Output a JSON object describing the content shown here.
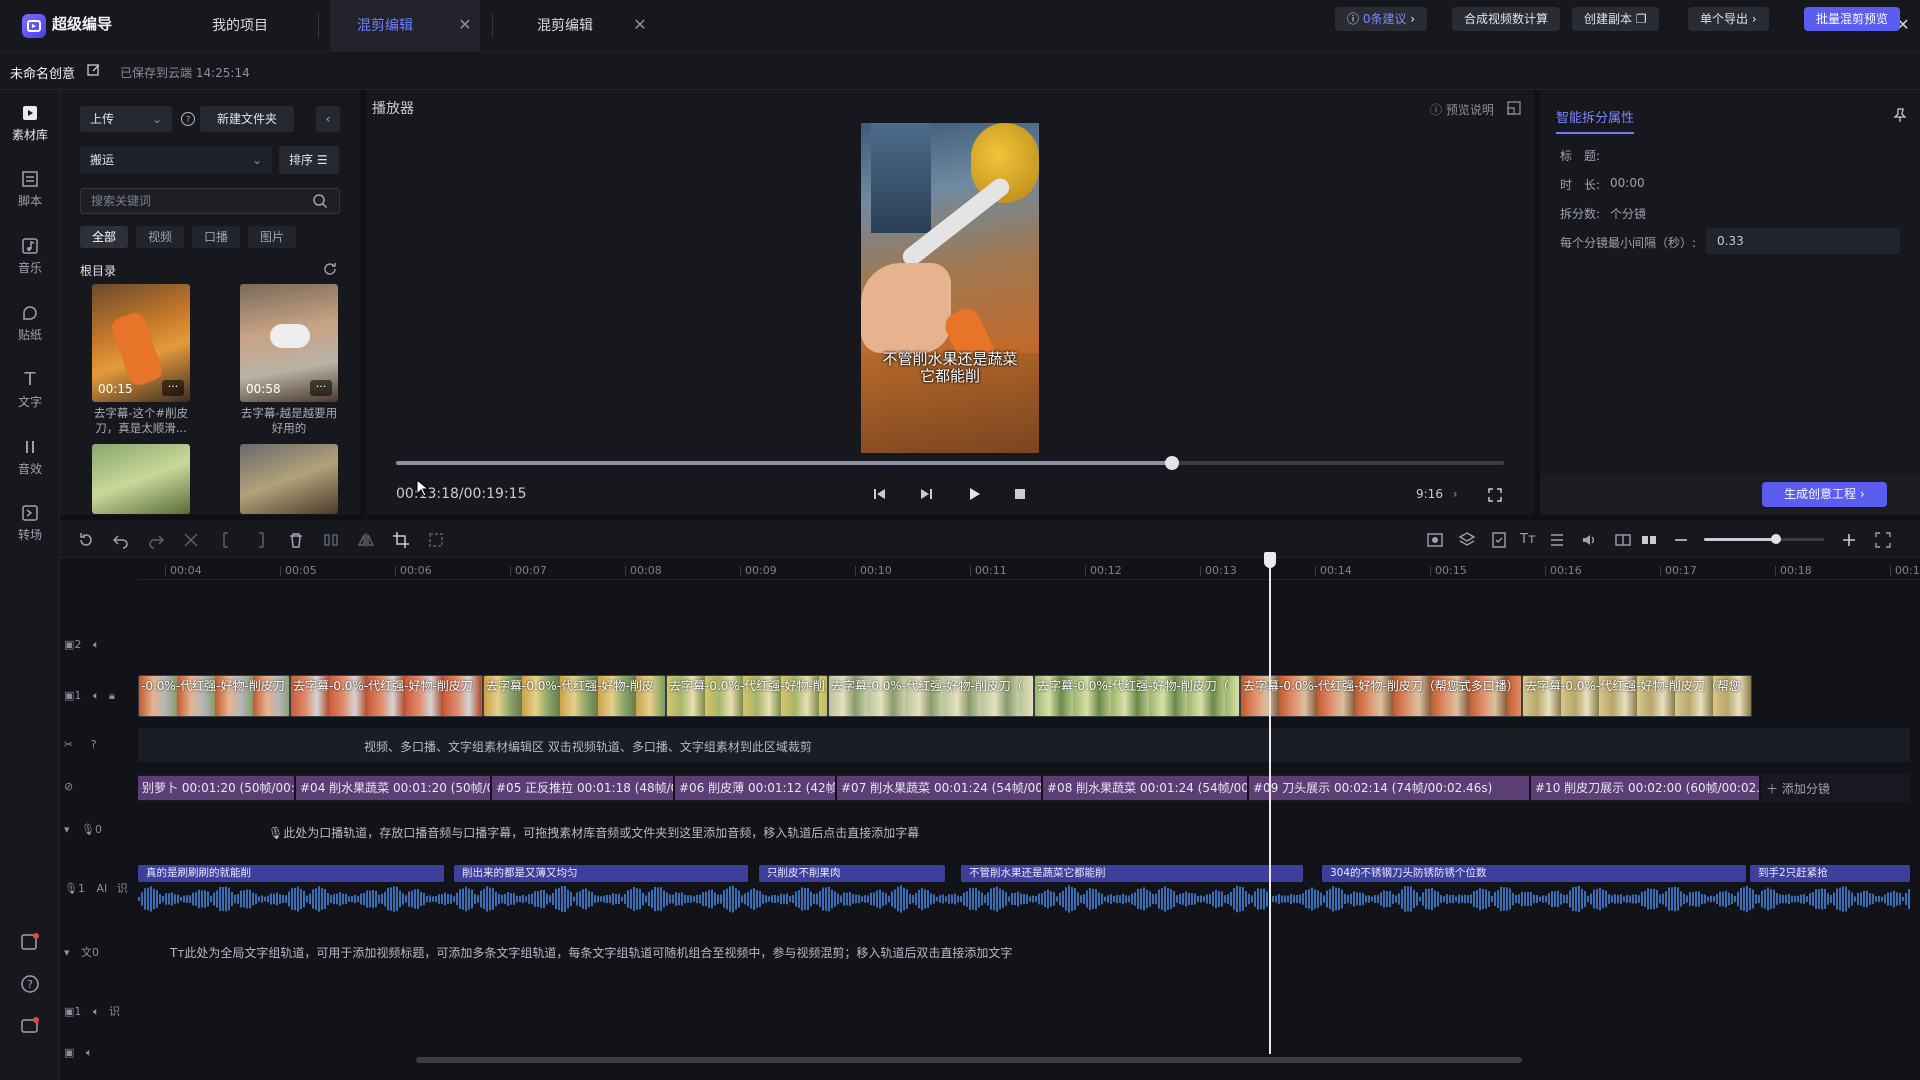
{
  "app": {
    "name": "超级编导",
    "icon": "app-logo-icon"
  },
  "tabs": [
    {
      "label": "我的项目"
    },
    {
      "label": "混剪编辑",
      "active": true
    },
    {
      "label": "混剪编辑"
    }
  ],
  "project": {
    "name": "未命名创意",
    "saved_text": "已保存到云端 14:25:14"
  },
  "header_actions": {
    "suggest": "0条建议",
    "calc": "合成视频数计算",
    "copy": "创建副本",
    "export_single": "单个导出",
    "batch_preview": "批量混剪预览"
  },
  "nav": [
    {
      "label": "素材库",
      "icon": "library-icon",
      "active": true
    },
    {
      "label": "脚本",
      "icon": "script-icon"
    },
    {
      "label": "音乐",
      "icon": "music-icon"
    },
    {
      "label": "贴纸",
      "icon": "sticker-icon"
    },
    {
      "label": "文字",
      "icon": "text-icon"
    },
    {
      "label": "音效",
      "icon": "sound-effect-icon"
    },
    {
      "label": "转场",
      "icon": "transition-icon"
    }
  ],
  "library": {
    "upload": "上传",
    "new_folder": "新建文件夹",
    "folder_select": "搬运",
    "sort": "排序",
    "search_placeholder": "搜索关键词",
    "filters": [
      "全部",
      "视频",
      "口播",
      "图片"
    ],
    "root_label": "根目录",
    "items": [
      {
        "duration": "00:15",
        "caption": "去字幕-这个#削皮刀，真是太顺滑..."
      },
      {
        "duration": "00:58",
        "caption": "去字幕-越是越要用好用的"
      },
      {
        "duration": "",
        "caption": ""
      },
      {
        "duration": "",
        "caption": ""
      }
    ]
  },
  "player": {
    "title": "播放器",
    "preview_help": "预览说明",
    "overlay_text": "不管削水果还是蔬菜\n它都能削",
    "time": "00:13:18/00:19:15",
    "aspect": "9:16",
    "progress": 0.7
  },
  "props": {
    "title": "智能拆分属性",
    "label_title": "标　题:",
    "label_duration": "时　长:",
    "duration_value": "00:00",
    "label_split": "拆分数:",
    "split_value": "个分镜",
    "label_min_interval": "每个分镜最小间隔（秒）:",
    "min_interval_value": "0.33",
    "generate_btn": "生成创意工程"
  },
  "timeline": {
    "ruler": [
      "00:04",
      "00:05",
      "00:06",
      "00:07",
      "00:08",
      "00:09",
      "00:10",
      "00:11",
      "00:12",
      "00:13",
      "00:14",
      "00:15",
      "00:16",
      "00:17",
      "00:18",
      "00:1"
    ],
    "zoom": 0.6,
    "tracks": {
      "v2": "2",
      "v1": "1",
      "voice": "0",
      "audio1": "1",
      "text": "文0",
      "music": "1"
    },
    "clips": [
      "-0.0%-代红强-好物-削皮刀",
      "去字幕-0.0%-代红强-好物-削皮刀",
      "去字幕-0.0%-代红强-好物-削皮",
      "去字幕-0.0%-代红强-好物-削",
      "去字幕-0.0%-代红强-好物-削皮刀（",
      "去字幕-0.0%-代红强-好物-削皮刀（",
      "去字幕-0.0%-代红强-好物-削皮刀（帮您式多口播）",
      "去字幕-0.0%-代红强-好物-削皮刀（帮您"
    ],
    "drop_hint": "视频、多口播、文字组素材编辑区   双击视频轨道、多口播、文字组素材到此区域裁剪",
    "segments": [
      "别萝卜 00:01:20 (50帧/00:01",
      "#04 削水果蔬菜 00:01:20 (50帧/0",
      "#05 正反推拉 00:01:18 (48帧/0(",
      "#06 削皮薄 00:01:12 (42帧/",
      "#07 削水果蔬菜 00:01:24 (54帧/00:(",
      "#08 削水果蔬菜 00:01:24 (54帧/00:(",
      "#09 刀头展示 00:02:14 (74帧/00:02.46s)",
      "#10 削皮刀展示 00:02:00 (60帧/00:02.0("
    ],
    "add_segment": "添加分镜",
    "voice_hint": "此处为口播轨道，存放口播音频与口播字幕，可拖拽素材库音频或文件夹到这里添加音频，移入轨道后点击直接添加字幕",
    "subtitles": [
      "真的是刷刷刷的就能削",
      "削出来的都是又薄又均匀",
      "只削皮不削果肉",
      "不管削水果还是蔬菜它都能削",
      "304的不锈钢刀头防锈防锈个位数",
      "到手2只赶紧抢"
    ],
    "text_hint": "此处为全局文字组轨道，可用于添加视频标题，可添加多条文字组轨道，每条文字组轨道可随机组合至视频中，参与视频混剪；移入轨道后双击直接添加文字"
  },
  "colors": {
    "accent": "#5b5cf0",
    "tab_active": "#6f7cff",
    "segment": "#5a3e74",
    "subtitle": "#3d3f9c",
    "waveform": "#3a6fb8"
  }
}
